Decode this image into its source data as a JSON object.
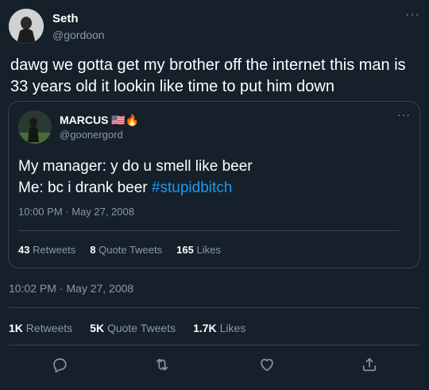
{
  "tweet": {
    "author_name": "Seth",
    "author_handle": "@gordoon",
    "text": "dawg we gotta get my brother off the internet this man is 33 years old it lookin like time to put him down",
    "timestamp": "10:02 PM · May 27, 2008",
    "stats": {
      "retweets_count": "1K",
      "retweets_label": "Retweets",
      "quote_count": "5K",
      "quote_label": "Quote Tweets",
      "likes_count": "1.7K",
      "likes_label": "Likes"
    }
  },
  "quoted": {
    "author_name": "MARCUS 🇺🇸🔥",
    "author_handle": "@goonergord",
    "line1": "My manager: y do u smell like beer",
    "line2_prefix": "Me: bc i drank beer ",
    "hashtag": "#stupidbitch",
    "timestamp": "10:00 PM · May 27, 2008",
    "stats": {
      "retweets_count": "43",
      "retweets_label": "Retweets",
      "quote_count": "8",
      "quote_label": "Quote Tweets",
      "likes_count": "165",
      "likes_label": "Likes"
    }
  },
  "icons": {
    "more": "more-horizontal-icon",
    "reply": "reply-icon",
    "retweet": "retweet-icon",
    "like": "heart-icon",
    "share": "share-icon"
  },
  "colors": {
    "background": "#15202b",
    "secondary_text": "#8b98a5",
    "border": "#38444d",
    "link": "#1d9bf0"
  },
  "more_glyph": "···"
}
